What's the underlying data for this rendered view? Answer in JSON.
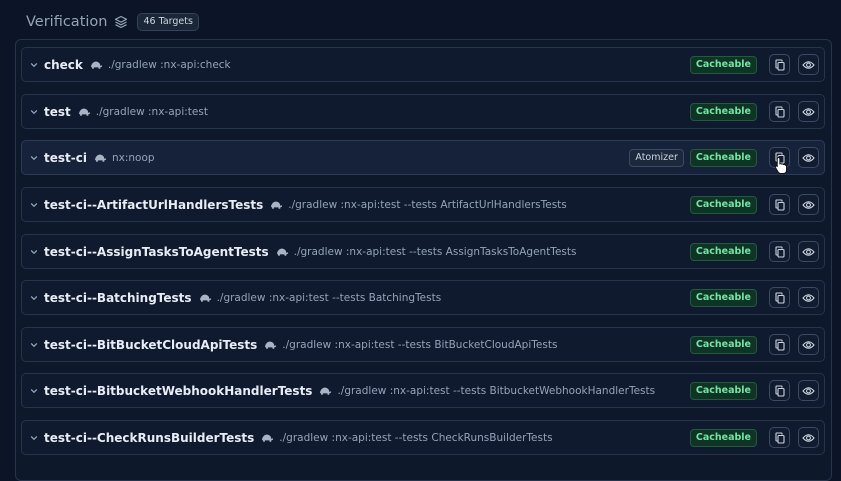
{
  "header": {
    "title": "Verification",
    "targets_badge": "46 Targets"
  },
  "rows": [
    {
      "name": "check",
      "command": "./gradlew :nx-api:check",
      "cacheable": "Cacheable"
    },
    {
      "name": "test",
      "command": "./gradlew :nx-api:test",
      "cacheable": "Cacheable"
    },
    {
      "name": "test-ci",
      "command": "nx:noop",
      "atomizer": "Atomizer",
      "cacheable": "Cacheable"
    },
    {
      "name": "test-ci--ArtifactUrlHandlersTests",
      "command": "./gradlew :nx-api:test --tests ArtifactUrlHandlersTests",
      "cacheable": "Cacheable"
    },
    {
      "name": "test-ci--AssignTasksToAgentTests",
      "command": "./gradlew :nx-api:test --tests AssignTasksToAgentTests",
      "cacheable": "Cacheable"
    },
    {
      "name": "test-ci--BatchingTests",
      "command": "./gradlew :nx-api:test --tests BatchingTests",
      "cacheable": "Cacheable"
    },
    {
      "name": "test-ci--BitBucketCloudApiTests",
      "command": "./gradlew :nx-api:test --tests BitBucketCloudApiTests",
      "cacheable": "Cacheable"
    },
    {
      "name": "test-ci--BitbucketWebhookHandlerTests",
      "command": "./gradlew :nx-api:test --tests BitbucketWebhookHandlerTests",
      "cacheable": "Cacheable"
    },
    {
      "name": "test-ci--CheckRunsBuilderTests",
      "command": "./gradlew :nx-api:test --tests CheckRunsBuilderTests",
      "cacheable": "Cacheable"
    }
  ],
  "colors": {
    "background": "#0c1527",
    "cacheable_text": "#6ee7a3",
    "cacheable_bg": "#0f3325"
  },
  "icons": [
    "layers-icon",
    "chevron-down-icon",
    "turtle-icon",
    "copy-icon",
    "eye-icon",
    "cursor-icon"
  ]
}
